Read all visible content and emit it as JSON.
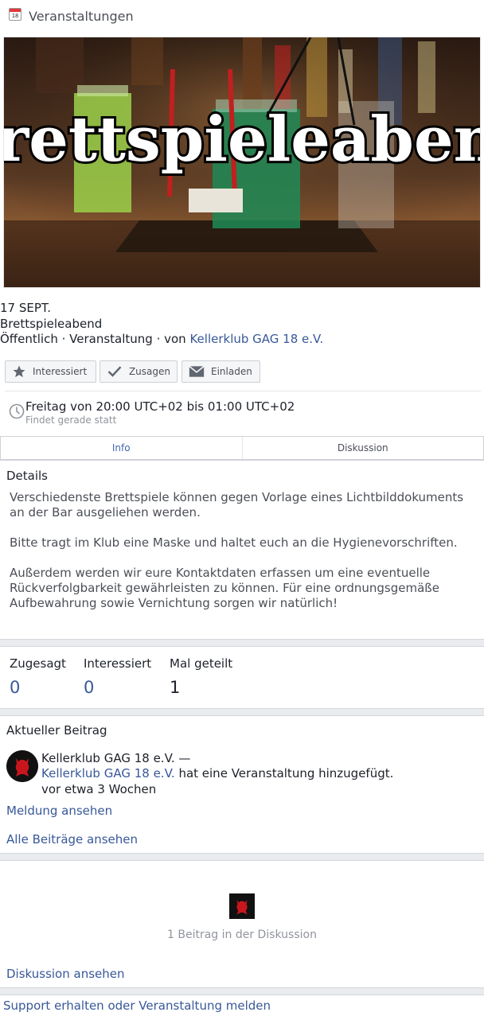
{
  "header": {
    "title": "Veranstaltungen",
    "calendar_day": "18",
    "icon": "calendar-icon"
  },
  "banner": {
    "title": "Brettspieleabend"
  },
  "event": {
    "date": "17 SEPT.",
    "name": "Brettspieleabend",
    "meta_prefix": "Öffentlich · Veranstaltung · von ",
    "organizer": "Kellerklub GAG 18 e.V."
  },
  "actions": {
    "interested": {
      "label": "Interessiert",
      "icon": "star-icon"
    },
    "accept": {
      "label": "Zusagen",
      "icon": "check-icon"
    },
    "invite": {
      "label": "Einladen",
      "icon": "envelope-icon"
    }
  },
  "time": {
    "main": "Freitag von 20:00 UTC+02 bis 01:00 UTC+02",
    "status": "Findet gerade statt",
    "icon": "clock-icon"
  },
  "tabs": [
    {
      "label": "Info",
      "active": true
    },
    {
      "label": "Diskussion",
      "active": false
    }
  ],
  "details": {
    "heading": "Details",
    "paragraphs": [
      "Verschiedenste Brettspiele können gegen Vorlage eines Lichtbilddokuments an der Bar ausgeliehen werden.",
      "Bitte tragt im Klub eine Maske und haltet euch an die Hygienevorschriften.",
      "Außerdem werden wir eure Kontaktdaten erfassen um eine eventuelle Rückverfolgbarkeit gewährleisten zu können. Für eine ordnungsgemäße Aufbewahrung sowie Vernichtung sorgen wir natürlich!"
    ]
  },
  "stats": [
    {
      "label": "Zugesagt",
      "value": "0"
    },
    {
      "label": "Interessiert",
      "value": "0"
    },
    {
      "label": "Mal geteilt",
      "value": "1"
    }
  ],
  "post": {
    "heading": "Aktueller Beitrag",
    "author_line": "Kellerklub GAG 18 e.V. —",
    "author_link": "Kellerklub GAG 18 e.V.",
    "action_text": " hat eine Veranstaltung hinzugefügt.",
    "time": "vor etwa 3 Wochen",
    "view_post": "Meldung ansehen",
    "all_posts": "Alle Beiträge ansehen"
  },
  "discussion": {
    "count_text": "1 Beitrag in der Diskussion",
    "view_link": "Diskussion ansehen"
  },
  "footer": {
    "support_link": "Support erhalten oder Veranstaltung melden"
  },
  "colors": {
    "link": "#385898",
    "accent": "#4267b2",
    "band": "#e9ebee"
  }
}
